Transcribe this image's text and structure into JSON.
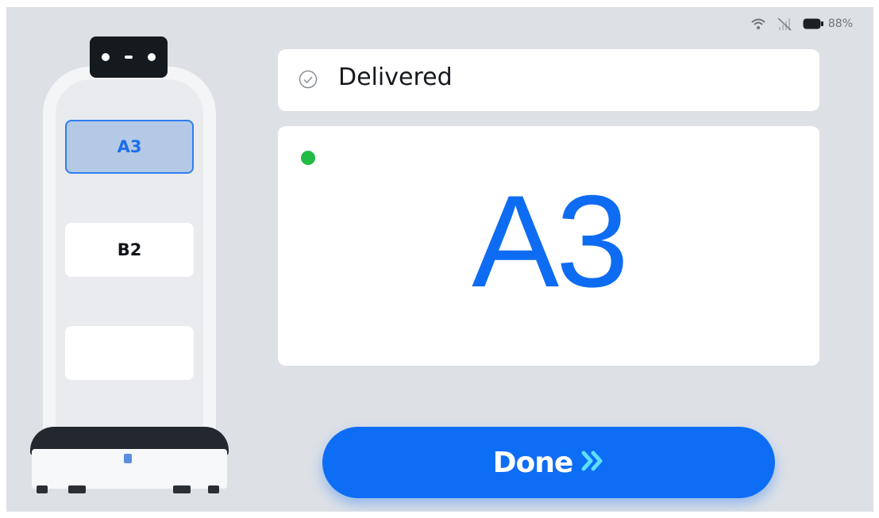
{
  "status_bar": {
    "battery_text": "88%"
  },
  "robot": {
    "trays": [
      {
        "label": "A3",
        "active": true
      },
      {
        "label": "B2",
        "active": false
      },
      {
        "label": "",
        "active": false
      }
    ]
  },
  "status": {
    "label": "Delivered"
  },
  "destination": {
    "table": "A3",
    "indicator_color": "#22bb45"
  },
  "done_button": {
    "label": "Done",
    "icon": "double-chevron-right-icon"
  },
  "colors": {
    "accent": "#0e6df5",
    "chevron": "#5ce0ff",
    "background": "#dde1e6"
  }
}
